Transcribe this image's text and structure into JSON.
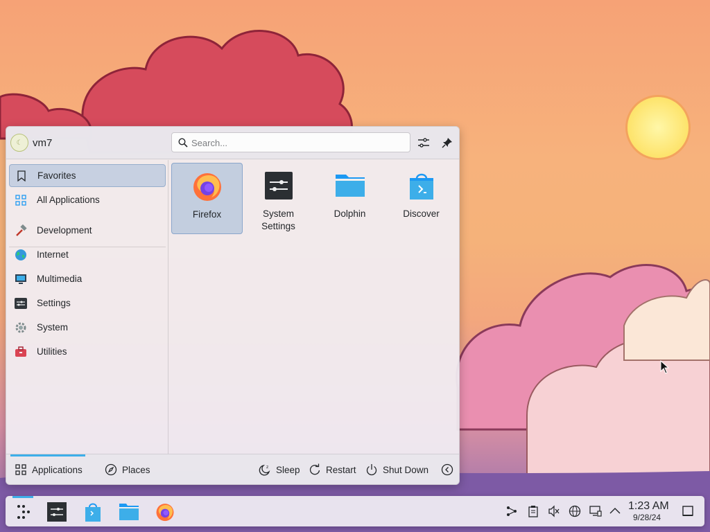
{
  "user": {
    "name": "vm7"
  },
  "search": {
    "placeholder": "Search..."
  },
  "categories": [
    {
      "label": "Favorites",
      "icon": "bookmark-icon"
    },
    {
      "label": "All Applications",
      "icon": "grid-icon"
    },
    {
      "label": "Development",
      "icon": "hammer-icon"
    },
    {
      "label": "Internet",
      "icon": "globe-icon"
    },
    {
      "label": "Multimedia",
      "icon": "monitor-icon"
    },
    {
      "label": "Settings",
      "icon": "settings-icon"
    },
    {
      "label": "System",
      "icon": "gear-icon"
    },
    {
      "label": "Utilities",
      "icon": "toolbox-icon"
    }
  ],
  "apps": [
    {
      "label": "Firefox",
      "icon": "firefox-icon"
    },
    {
      "label": "System Settings",
      "icon": "system-settings-icon"
    },
    {
      "label": "Dolphin",
      "icon": "folder-icon"
    },
    {
      "label": "Discover",
      "icon": "discover-bag-icon"
    }
  ],
  "footer": {
    "applications": "Applications",
    "places": "Places",
    "sleep": "Sleep",
    "restart": "Restart",
    "shutdown": "Shut Down"
  },
  "taskbar": {
    "apps": [
      "launcher-icon",
      "system-settings-icon",
      "discover-bag-icon",
      "folder-icon",
      "firefox-icon"
    ],
    "tray": [
      "kde-connect-icon",
      "clipboard-icon",
      "volume-muted-icon",
      "network-icon",
      "display-icon",
      "chevron-up-icon"
    ]
  },
  "clock": {
    "time": "1:23 AM",
    "date": "9/28/24"
  },
  "colors": {
    "accent": "#3daee9",
    "selection": "#93b2d4"
  }
}
